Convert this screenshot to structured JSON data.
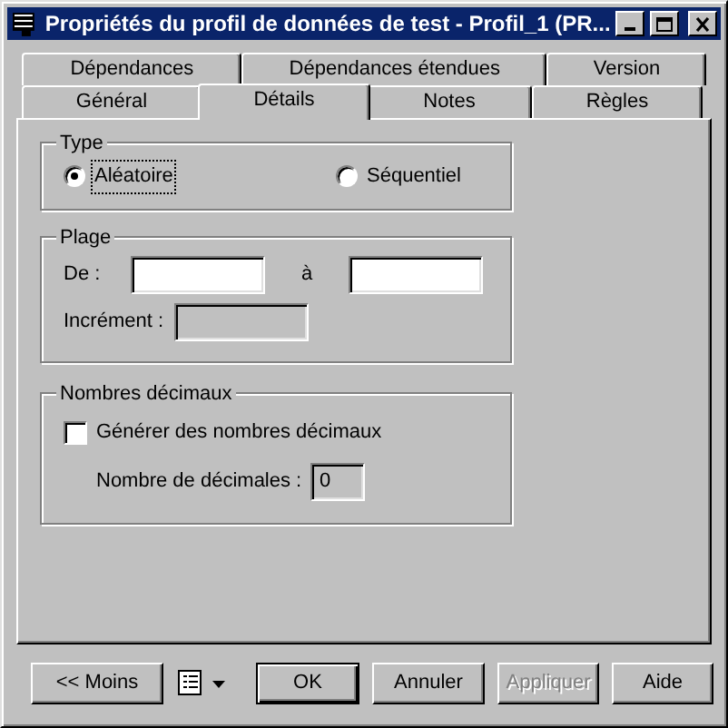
{
  "window": {
    "title": "Propriétés du profil de données de test - Profil_1 (PR..."
  },
  "tab_rows": [
    [
      {
        "label": "Dépendances",
        "selected": false
      },
      {
        "label": "Dépendances étendues",
        "selected": false
      },
      {
        "label": "Version",
        "selected": false
      }
    ],
    [
      {
        "label": "Général",
        "selected": false
      },
      {
        "label": "Détails",
        "selected": true
      },
      {
        "label": "Notes",
        "selected": false
      },
      {
        "label": "Règles",
        "selected": false
      }
    ]
  ],
  "type_group": {
    "title": "Type",
    "options": [
      {
        "label": "Aléatoire",
        "selected": true
      },
      {
        "label": "Séquentiel",
        "selected": false
      }
    ]
  },
  "range_group": {
    "title": "Plage",
    "from_label": "De :",
    "to_label": "à",
    "increment_label": "Incrément :"
  },
  "decimals_group": {
    "title": "Nombres décimaux",
    "checkbox": {
      "label": "Générer des nombres décimaux",
      "checked": false
    },
    "count_label": "Nombre de décimales :",
    "count_value": "0"
  },
  "buttons": [
    {
      "label": "<< Moins",
      "disabled": false,
      "default": false
    },
    {
      "label": "OK",
      "disabled": false,
      "default": true
    },
    {
      "label": "Annuler",
      "disabled": false,
      "default": false
    },
    {
      "label": "Appliquer",
      "disabled": true,
      "default": false
    },
    {
      "label": "Aide",
      "disabled": false,
      "default": false
    }
  ]
}
